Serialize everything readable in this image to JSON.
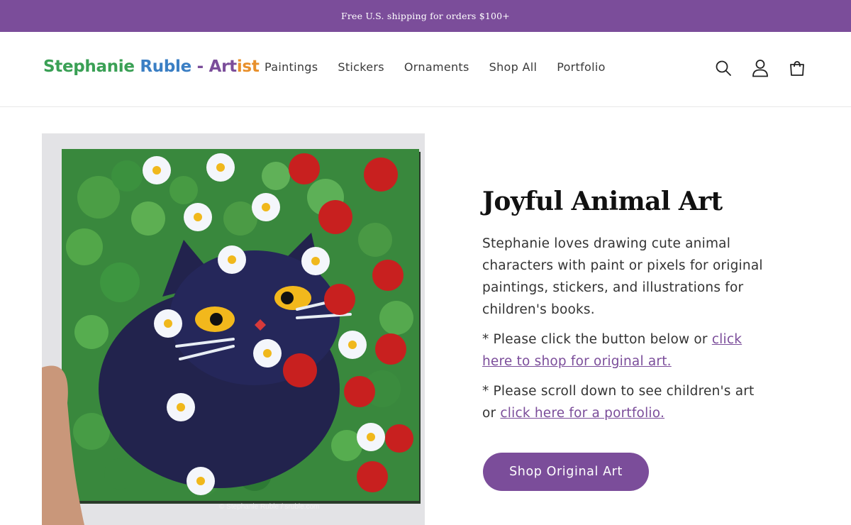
{
  "announcement": {
    "text": "Free U.S. shipping for orders $100+"
  },
  "header": {
    "logo": {
      "part1": "Stephanie ",
      "part2": "Ruble",
      "part3": " - Art",
      "part4": "ist"
    },
    "nav": [
      {
        "label": "Paintings"
      },
      {
        "label": "Stickers"
      },
      {
        "label": "Ornaments"
      },
      {
        "label": "Shop All"
      },
      {
        "label": "Portfolio"
      }
    ],
    "icons": [
      "search-icon",
      "account-icon",
      "cart-icon"
    ]
  },
  "hero": {
    "image_caption": "© Stephanie Ruble / sruble.com",
    "title": "Joyful Animal Art",
    "paragraph1": "Stephanie loves drawing cute animal characters with paint or pixels for original paintings, stickers, and illustrations for children's books.",
    "paragraph2_prefix": "* Please click the button below or ",
    "paragraph2_link": "click here to shop for original art.",
    "paragraph3_prefix": "* Please scroll down to see children's art or ",
    "paragraph3_link": "click here for a portfolio.",
    "button_label": "Shop Original Art"
  },
  "colors": {
    "brand_purple": "#7b4d9a",
    "logo_green": "#3aa055",
    "logo_blue": "#3b7fc4",
    "logo_orange": "#e8902c"
  }
}
